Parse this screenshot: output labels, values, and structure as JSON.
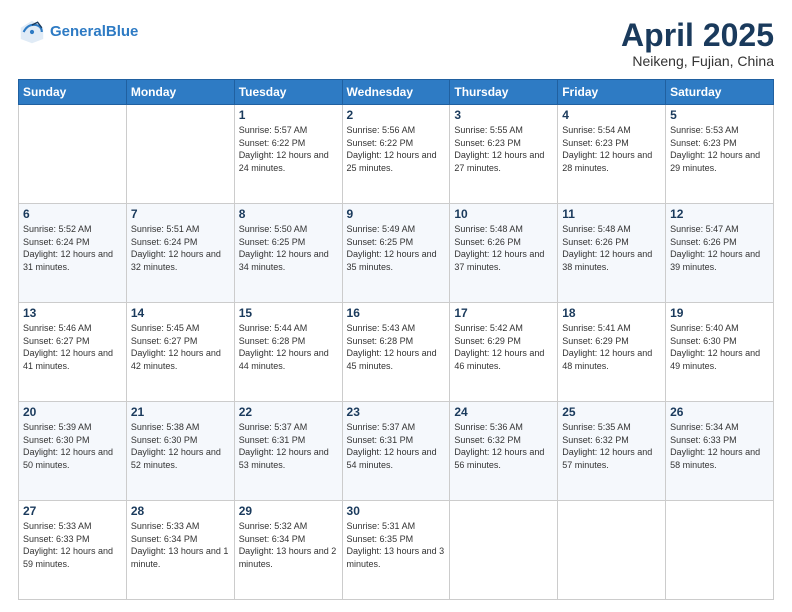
{
  "header": {
    "logo_line1": "General",
    "logo_line2": "Blue",
    "month": "April 2025",
    "location": "Neikeng, Fujian, China"
  },
  "weekdays": [
    "Sunday",
    "Monday",
    "Tuesday",
    "Wednesday",
    "Thursday",
    "Friday",
    "Saturday"
  ],
  "weeks": [
    [
      {
        "day": "",
        "info": ""
      },
      {
        "day": "",
        "info": ""
      },
      {
        "day": "1",
        "info": "Sunrise: 5:57 AM\nSunset: 6:22 PM\nDaylight: 12 hours\nand 24 minutes."
      },
      {
        "day": "2",
        "info": "Sunrise: 5:56 AM\nSunset: 6:22 PM\nDaylight: 12 hours\nand 25 minutes."
      },
      {
        "day": "3",
        "info": "Sunrise: 5:55 AM\nSunset: 6:23 PM\nDaylight: 12 hours\nand 27 minutes."
      },
      {
        "day": "4",
        "info": "Sunrise: 5:54 AM\nSunset: 6:23 PM\nDaylight: 12 hours\nand 28 minutes."
      },
      {
        "day": "5",
        "info": "Sunrise: 5:53 AM\nSunset: 6:23 PM\nDaylight: 12 hours\nand 29 minutes."
      }
    ],
    [
      {
        "day": "6",
        "info": "Sunrise: 5:52 AM\nSunset: 6:24 PM\nDaylight: 12 hours\nand 31 minutes."
      },
      {
        "day": "7",
        "info": "Sunrise: 5:51 AM\nSunset: 6:24 PM\nDaylight: 12 hours\nand 32 minutes."
      },
      {
        "day": "8",
        "info": "Sunrise: 5:50 AM\nSunset: 6:25 PM\nDaylight: 12 hours\nand 34 minutes."
      },
      {
        "day": "9",
        "info": "Sunrise: 5:49 AM\nSunset: 6:25 PM\nDaylight: 12 hours\nand 35 minutes."
      },
      {
        "day": "10",
        "info": "Sunrise: 5:48 AM\nSunset: 6:26 PM\nDaylight: 12 hours\nand 37 minutes."
      },
      {
        "day": "11",
        "info": "Sunrise: 5:48 AM\nSunset: 6:26 PM\nDaylight: 12 hours\nand 38 minutes."
      },
      {
        "day": "12",
        "info": "Sunrise: 5:47 AM\nSunset: 6:26 PM\nDaylight: 12 hours\nand 39 minutes."
      }
    ],
    [
      {
        "day": "13",
        "info": "Sunrise: 5:46 AM\nSunset: 6:27 PM\nDaylight: 12 hours\nand 41 minutes."
      },
      {
        "day": "14",
        "info": "Sunrise: 5:45 AM\nSunset: 6:27 PM\nDaylight: 12 hours\nand 42 minutes."
      },
      {
        "day": "15",
        "info": "Sunrise: 5:44 AM\nSunset: 6:28 PM\nDaylight: 12 hours\nand 44 minutes."
      },
      {
        "day": "16",
        "info": "Sunrise: 5:43 AM\nSunset: 6:28 PM\nDaylight: 12 hours\nand 45 minutes."
      },
      {
        "day": "17",
        "info": "Sunrise: 5:42 AM\nSunset: 6:29 PM\nDaylight: 12 hours\nand 46 minutes."
      },
      {
        "day": "18",
        "info": "Sunrise: 5:41 AM\nSunset: 6:29 PM\nDaylight: 12 hours\nand 48 minutes."
      },
      {
        "day": "19",
        "info": "Sunrise: 5:40 AM\nSunset: 6:30 PM\nDaylight: 12 hours\nand 49 minutes."
      }
    ],
    [
      {
        "day": "20",
        "info": "Sunrise: 5:39 AM\nSunset: 6:30 PM\nDaylight: 12 hours\nand 50 minutes."
      },
      {
        "day": "21",
        "info": "Sunrise: 5:38 AM\nSunset: 6:30 PM\nDaylight: 12 hours\nand 52 minutes."
      },
      {
        "day": "22",
        "info": "Sunrise: 5:37 AM\nSunset: 6:31 PM\nDaylight: 12 hours\nand 53 minutes."
      },
      {
        "day": "23",
        "info": "Sunrise: 5:37 AM\nSunset: 6:31 PM\nDaylight: 12 hours\nand 54 minutes."
      },
      {
        "day": "24",
        "info": "Sunrise: 5:36 AM\nSunset: 6:32 PM\nDaylight: 12 hours\nand 56 minutes."
      },
      {
        "day": "25",
        "info": "Sunrise: 5:35 AM\nSunset: 6:32 PM\nDaylight: 12 hours\nand 57 minutes."
      },
      {
        "day": "26",
        "info": "Sunrise: 5:34 AM\nSunset: 6:33 PM\nDaylight: 12 hours\nand 58 minutes."
      }
    ],
    [
      {
        "day": "27",
        "info": "Sunrise: 5:33 AM\nSunset: 6:33 PM\nDaylight: 12 hours\nand 59 minutes."
      },
      {
        "day": "28",
        "info": "Sunrise: 5:33 AM\nSunset: 6:34 PM\nDaylight: 13 hours\nand 1 minute."
      },
      {
        "day": "29",
        "info": "Sunrise: 5:32 AM\nSunset: 6:34 PM\nDaylight: 13 hours\nand 2 minutes."
      },
      {
        "day": "30",
        "info": "Sunrise: 5:31 AM\nSunset: 6:35 PM\nDaylight: 13 hours\nand 3 minutes."
      },
      {
        "day": "",
        "info": ""
      },
      {
        "day": "",
        "info": ""
      },
      {
        "day": "",
        "info": ""
      }
    ]
  ]
}
